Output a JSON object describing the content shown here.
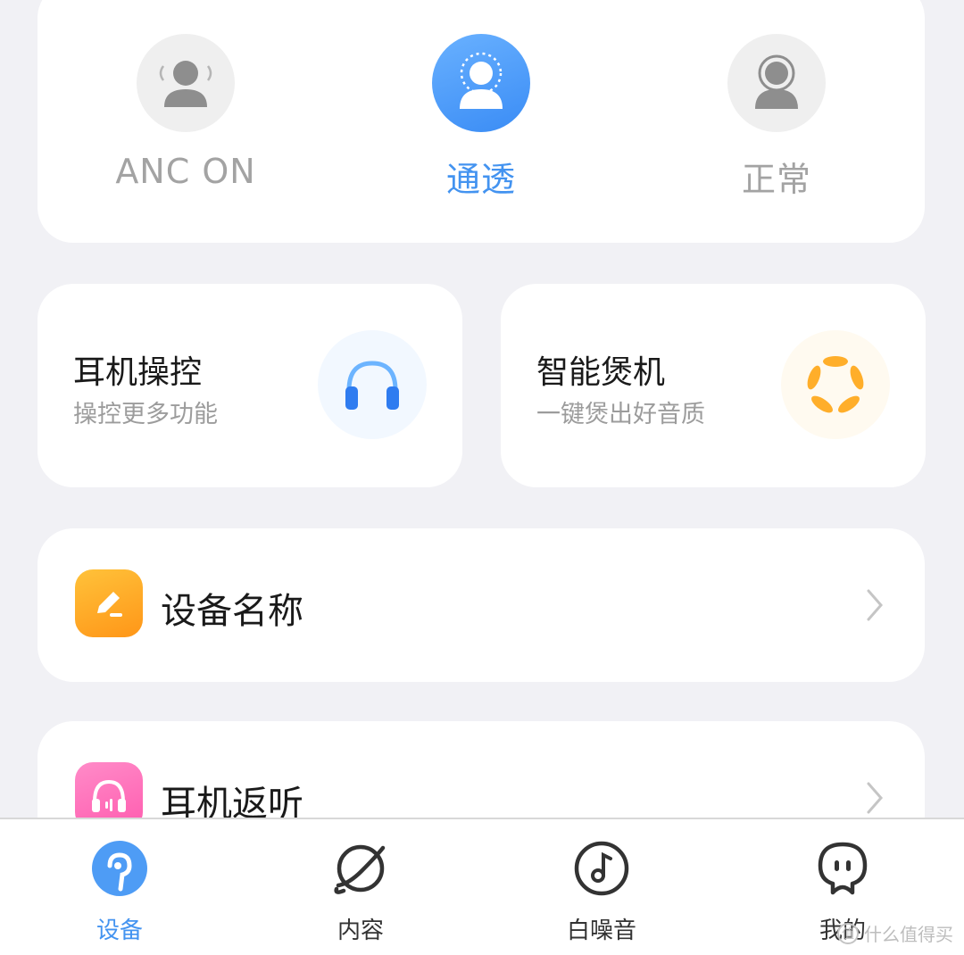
{
  "modes": [
    {
      "label": "ANC ON",
      "icon": "anc-person-icon",
      "active": false
    },
    {
      "label": "通透",
      "icon": "transparency-person-icon",
      "active": true
    },
    {
      "label": "正常",
      "icon": "normal-person-icon",
      "active": false
    }
  ],
  "features": [
    {
      "title": "耳机操控",
      "subtitle": "操控更多功能",
      "icon": "headphones-icon"
    },
    {
      "title": "智能煲机",
      "subtitle": "一键煲出好音质",
      "icon": "burn-in-ring-icon"
    }
  ],
  "list": [
    {
      "label": "设备名称",
      "icon": "edit-pencil-icon"
    },
    {
      "label": "耳机返听",
      "icon": "headphone-monitor-icon"
    }
  ],
  "nav": [
    {
      "label": "设备",
      "icon": "earbud-icon",
      "active": true
    },
    {
      "label": "内容",
      "icon": "planet-icon",
      "active": false
    },
    {
      "label": "白噪音",
      "icon": "music-note-disc-icon",
      "active": false
    },
    {
      "label": "我的",
      "icon": "profile-face-icon",
      "active": false
    }
  ],
  "watermark": {
    "text": "什么值得买",
    "badge": "值"
  },
  "colors": {
    "accent": "#4393f0",
    "orange": "#ffa620",
    "pink": "#ff6ab8",
    "inactive": "#a3a3a3"
  }
}
